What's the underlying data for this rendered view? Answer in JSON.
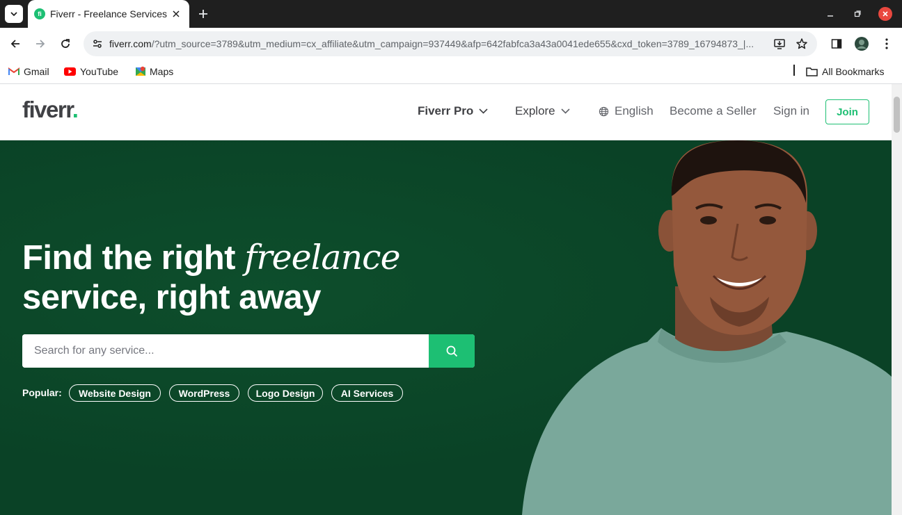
{
  "browser": {
    "tab": {
      "title": "Fiverr - Freelance Services Marketplace",
      "favicon_text": "fi"
    },
    "url": {
      "host": "fiverr.com",
      "rest": "/?utm_source=3789&utm_medium=cx_affiliate&utm_campaign=937449&afp=642fabfca3a43a0041ede655&cxd_token=3789_16794873_|..."
    },
    "bookmarks": [
      {
        "label": "Gmail"
      },
      {
        "label": "YouTube"
      },
      {
        "label": "Maps"
      }
    ],
    "all_bookmarks_label": "All Bookmarks"
  },
  "site": {
    "logo": "fiverr",
    "logo_dot": ".",
    "nav": {
      "pro": "Fiverr Pro",
      "explore": "Explore",
      "language": "English",
      "become_seller": "Become a Seller",
      "sign_in": "Sign in",
      "join": "Join"
    },
    "hero": {
      "headline_start": "Find the right ",
      "headline_emphasis": "freelance",
      "headline_line2": "service, right away",
      "search_placeholder": "Search for any service...",
      "popular_label": "Popular:",
      "popular_tags": [
        "Website Design",
        "WordPress",
        "Logo Design",
        "AI Services"
      ]
    }
  },
  "colors": {
    "brand_green": "#1dbf73",
    "hero_bg": "#0a4226",
    "text_dark": "#404145",
    "text_muted": "#62646a"
  }
}
